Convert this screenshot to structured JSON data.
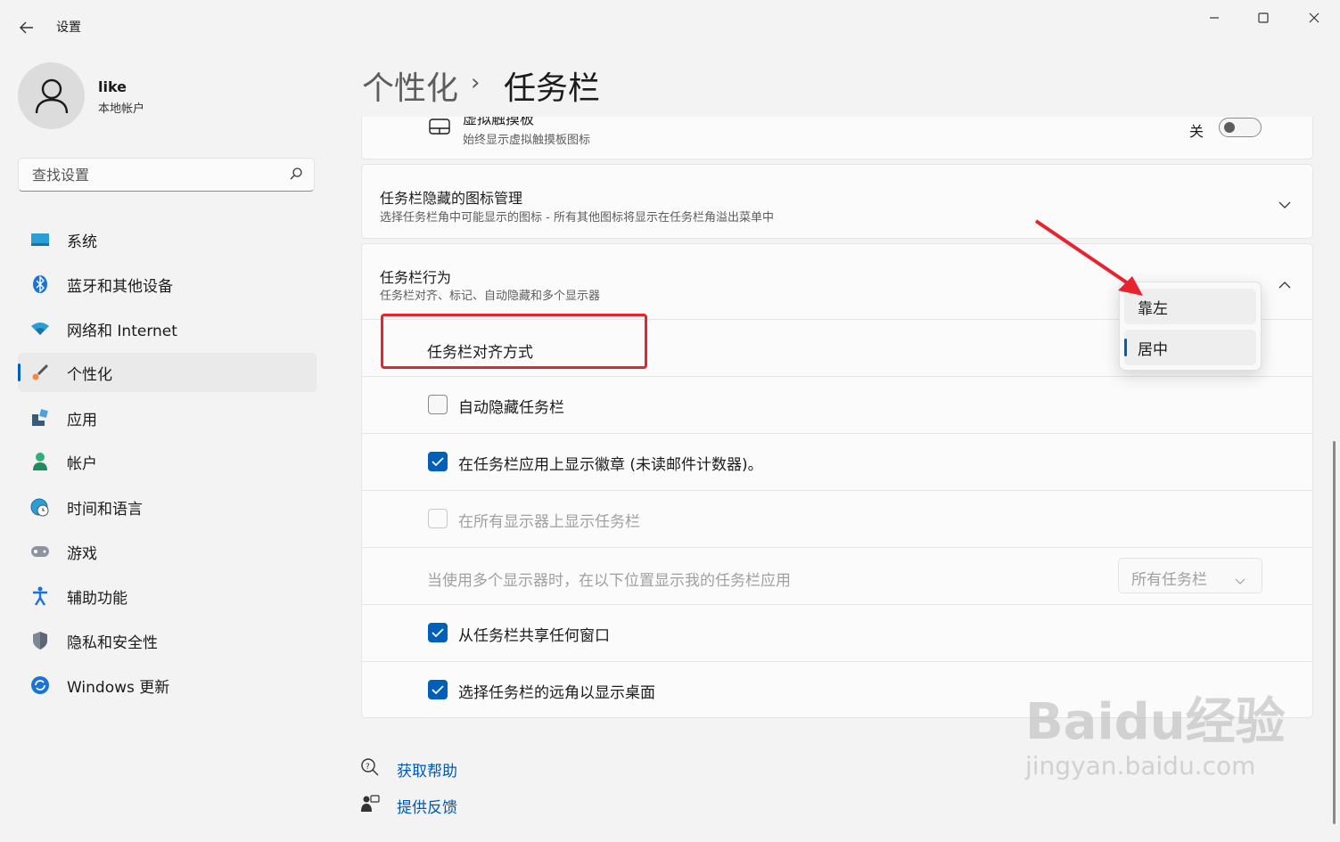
{
  "window": {
    "title": "设置"
  },
  "profile": {
    "name": "like",
    "type": "本地帐户"
  },
  "search": {
    "placeholder": "查找设置"
  },
  "nav": {
    "items": [
      {
        "label": "系统",
        "icon": "monitor-icon"
      },
      {
        "label": "蓝牙和其他设备",
        "icon": "bluetooth-icon"
      },
      {
        "label": "网络和 Internet",
        "icon": "wifi-icon"
      },
      {
        "label": "个性化",
        "icon": "brush-icon",
        "active": true
      },
      {
        "label": "应用",
        "icon": "apps-icon"
      },
      {
        "label": "帐户",
        "icon": "account-icon"
      },
      {
        "label": "时间和语言",
        "icon": "globe-clock-icon"
      },
      {
        "label": "游戏",
        "icon": "gamepad-icon"
      },
      {
        "label": "辅助功能",
        "icon": "accessibility-icon"
      },
      {
        "label": "隐私和安全性",
        "icon": "shield-icon"
      },
      {
        "label": "Windows 更新",
        "icon": "update-icon"
      }
    ]
  },
  "breadcrumb": {
    "parent": "个性化",
    "separator": "›",
    "current": "任务栏"
  },
  "touchpad": {
    "title": "虚拟触摸板",
    "subtitle": "始终显示虚拟触摸板图标",
    "state_label": "关",
    "on": false
  },
  "hidden_icons": {
    "title": "任务栏隐藏的图标管理",
    "subtitle": "选择任务栏角中可能显示的图标 - 所有其他图标将显示在任务栏角溢出菜单中"
  },
  "behaviors": {
    "title": "任务栏行为",
    "subtitle": "任务栏对齐、标记、自动隐藏和多个显示器",
    "alignment_label": "任务栏对齐方式",
    "auto_hide": {
      "label": "自动隐藏任务栏",
      "checked": false
    },
    "badges": {
      "label": "在任务栏应用上显示徽章 (未读邮件计数器)。",
      "checked": true
    },
    "all_displays": {
      "label": "在所有显示器上显示任务栏",
      "checked": false,
      "disabled": true
    },
    "multi_display": {
      "label": "当使用多个显示器时，在以下位置显示我的任务栏应用",
      "value": "所有任务栏"
    },
    "share_window": {
      "label": "从任务栏共享任何窗口",
      "checked": true
    },
    "far_corner": {
      "label": "选择任务栏的远角以显示桌面",
      "checked": true
    }
  },
  "alignment_popup": {
    "options": [
      "靠左",
      "居中"
    ],
    "selected": "居中"
  },
  "links": {
    "help": "获取帮助",
    "feedback": "提供反馈"
  },
  "watermark": {
    "line1": "Baidu经验",
    "line2": "jingyan.baidu.com"
  },
  "colors": {
    "accent": "#005fb8",
    "annotation": "#e8232f"
  }
}
